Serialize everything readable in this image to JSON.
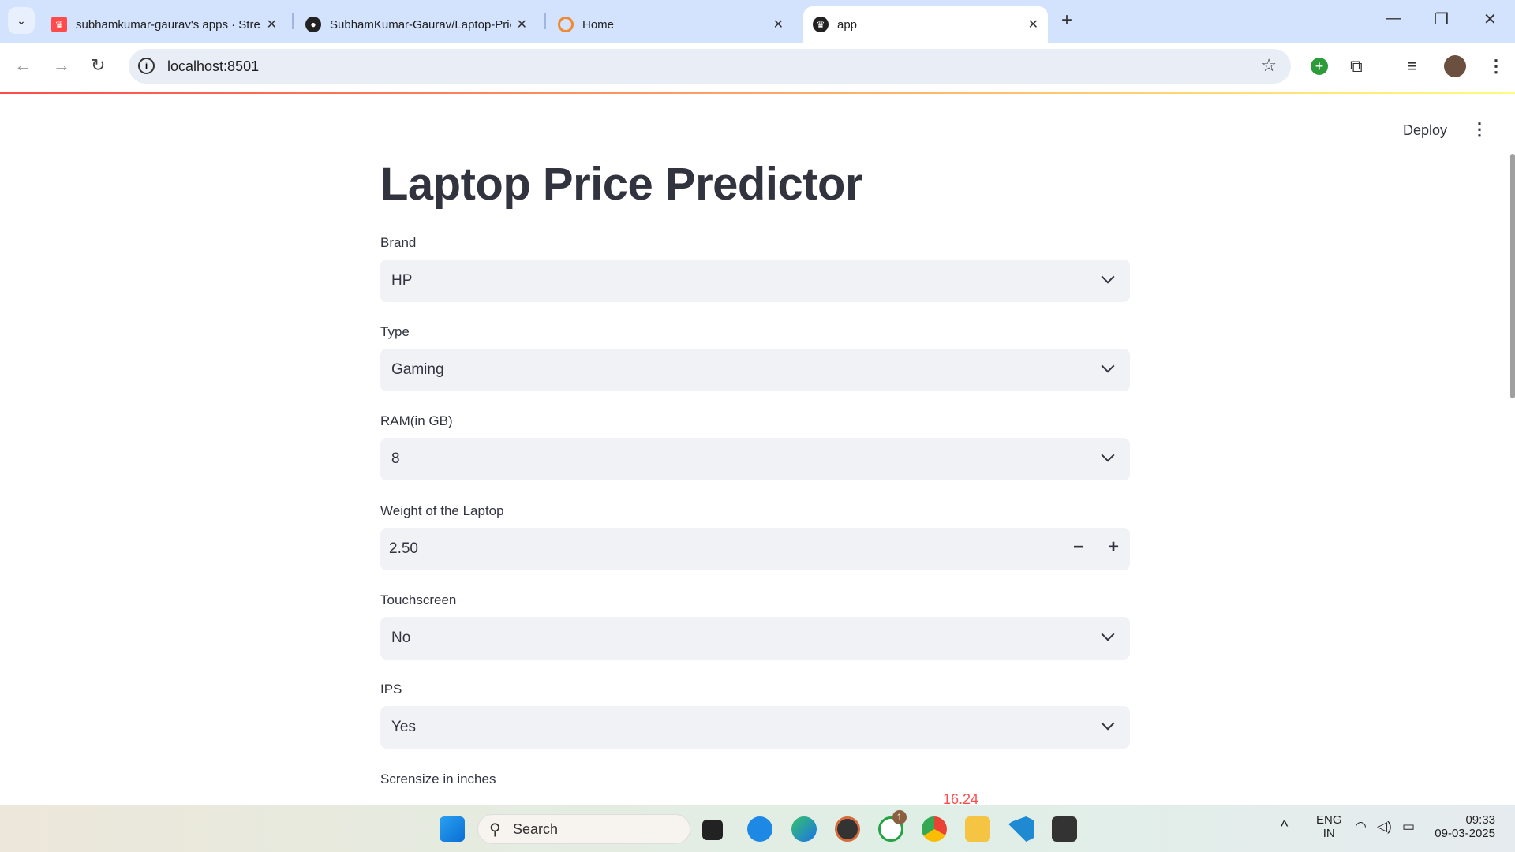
{
  "browser": {
    "tabs": [
      {
        "title": "subhamkumar-gaurav's apps · Streamlit"
      },
      {
        "title": "SubhamKumar-Gaurav/Laptop-Price"
      },
      {
        "title": "Home"
      },
      {
        "title": "app"
      }
    ],
    "url": "localhost:8501"
  },
  "app": {
    "deploy": "Deploy",
    "title": "Laptop Price Predictor",
    "fields": [
      {
        "label": "Brand",
        "value": "HP"
      },
      {
        "label": "Type",
        "value": "Gaming"
      },
      {
        "label": "RAM(in GB)",
        "value": "8"
      },
      {
        "label": "Weight of the Laptop",
        "value": "2.50"
      },
      {
        "label": "Touchscreen",
        "value": "No"
      },
      {
        "label": "IPS",
        "value": "Yes"
      },
      {
        "label": "Scrensize in inches",
        "value": "16.24"
      }
    ]
  },
  "taskbar": {
    "search": "Search",
    "whatsapp_badge": "1",
    "lang": "ENG",
    "region": "IN",
    "time": "09:33",
    "date": "09-03-2025"
  },
  "colors": {
    "accent": "#ff4b4b",
    "input_bg": "#f0f2f6",
    "text": "#31333f"
  }
}
